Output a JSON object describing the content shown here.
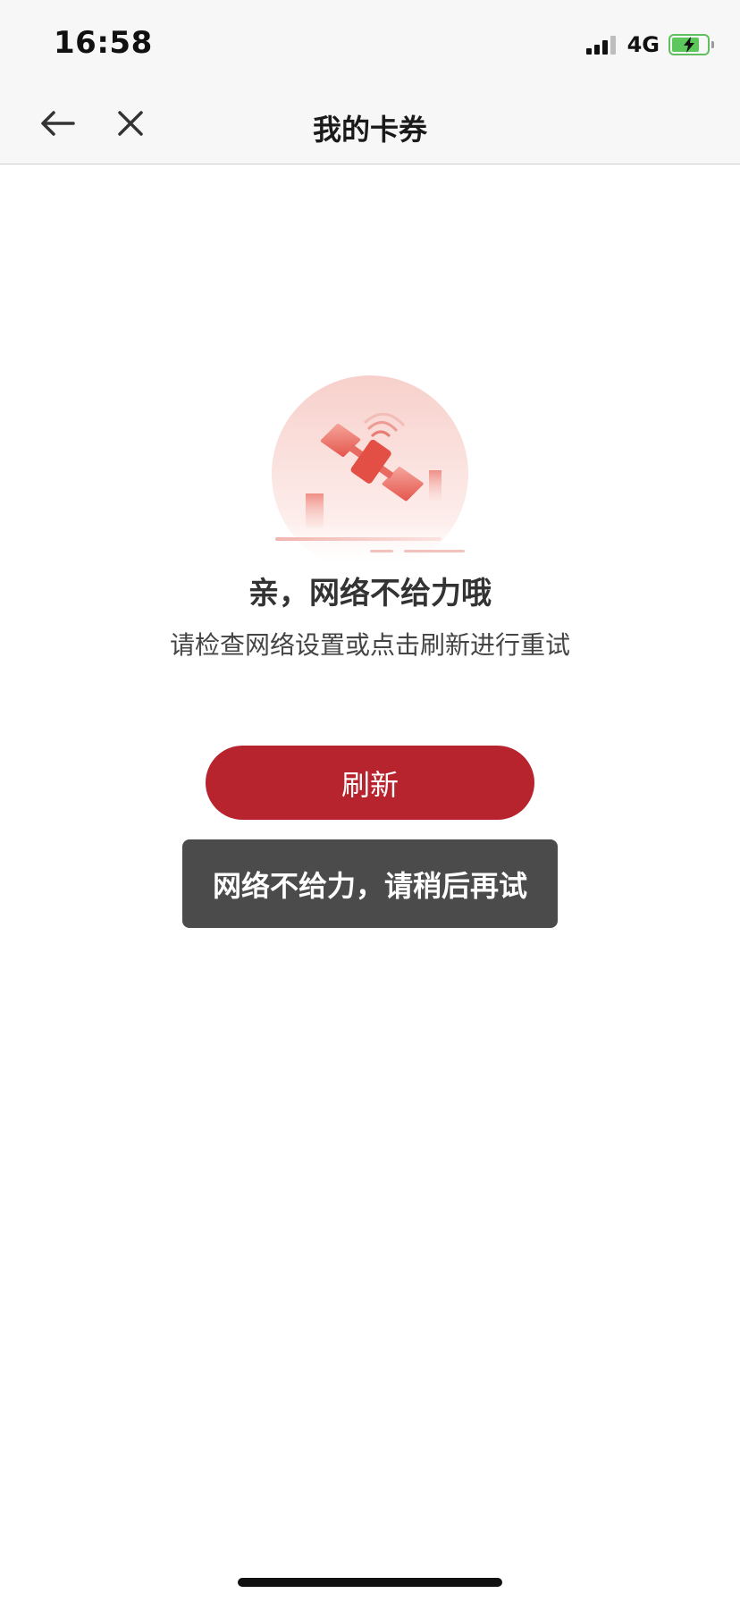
{
  "status_bar": {
    "time": "16:58",
    "network": "4G",
    "signal_bars": 4,
    "signal_active": 3,
    "battery_level": 0.8,
    "battery_color": "#5cc85c",
    "charging": true
  },
  "nav": {
    "title": "我的卡券",
    "back_icon": "arrow-left-icon",
    "close_icon": "close-icon"
  },
  "error": {
    "illustration_icon": "satellite-icon",
    "title": "亲，网络不给力哦",
    "subtitle": "请检查网络设置或点击刷新进行重试"
  },
  "refresh_button": {
    "label": "刷新",
    "color": "#b8242d"
  },
  "toast": {
    "message": "网络不给力，请稍后再试"
  }
}
